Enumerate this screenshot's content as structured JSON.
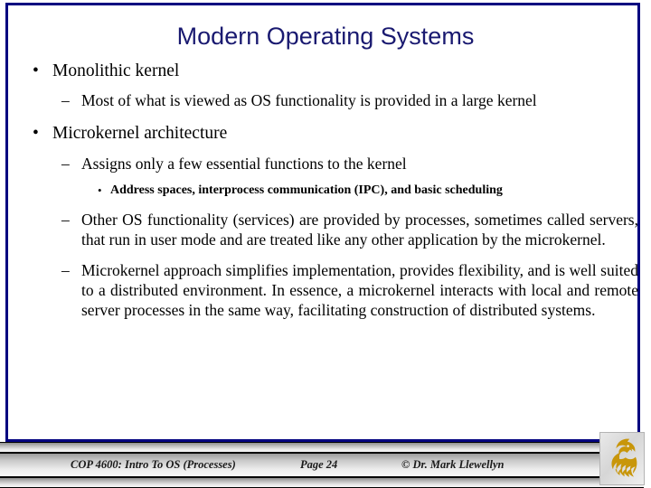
{
  "slide": {
    "title": "Modern Operating Systems",
    "title_color": "#191970",
    "frame_color": "#000080",
    "background": "#ffffff"
  },
  "content": {
    "bullets": [
      {
        "level": 1,
        "marker": "•",
        "text": "Monolithic kernel"
      },
      {
        "level": 2,
        "marker": "–",
        "text": "Most of what is viewed as OS functionality is provided in a large kernel"
      },
      {
        "level": 1,
        "marker": "•",
        "text": "Microkernel architecture"
      },
      {
        "level": 2,
        "marker": "–",
        "text": "Assigns only a few essential functions to the kernel"
      },
      {
        "level": 3,
        "marker": "•",
        "text": "Address spaces, interprocess communication (IPC), and basic scheduling"
      },
      {
        "level": 2,
        "marker": "–",
        "text": "Other OS functionality (services) are provided by processes, sometimes called servers, that run in user mode and are treated like any other application by the microkernel."
      },
      {
        "level": 2,
        "marker": "–",
        "text": "Microkernel approach simplifies implementation, provides flexibility, and is well suited to a distributed environment.  In essence, a microkernel interacts with local and remote server processes in the same way, facilitating construction of distributed systems."
      }
    ]
  },
  "footer": {
    "course": "COP 4600: Intro To OS  (Processes)",
    "page": "Page 24",
    "copyright": "© Dr. Mark Llewellyn",
    "logo_name": "ucf-pegasus-logo",
    "logo_color": "#C8960A"
  }
}
